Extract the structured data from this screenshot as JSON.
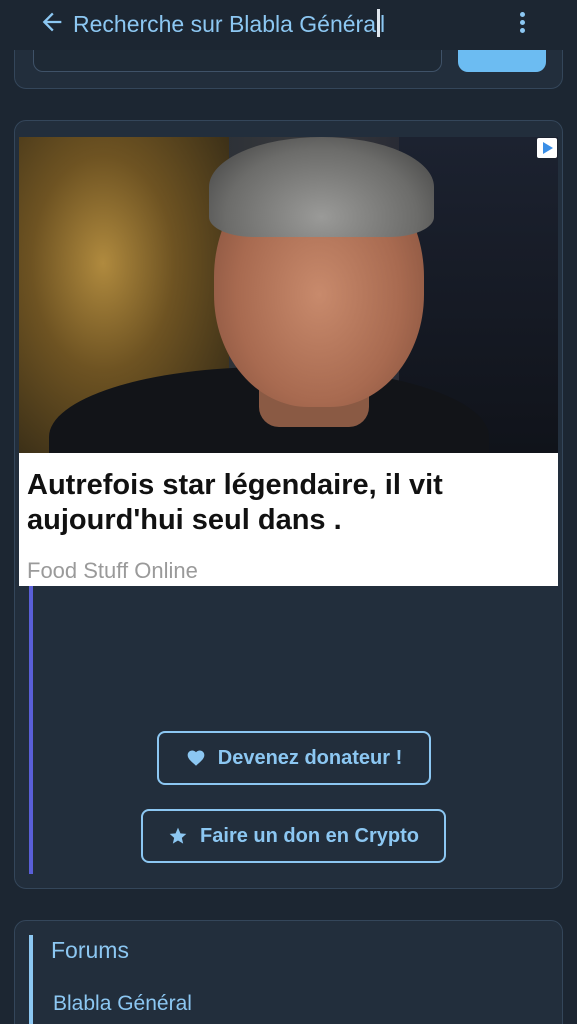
{
  "header": {
    "title": "Recherche sur Blabla Généra",
    "title_tail": "l"
  },
  "ad": {
    "headline": "Autrefois star légendaire, il vit aujourd'hui seul dans .",
    "source": "Food Stuff Online"
  },
  "donation": {
    "donate_label": "Devenez donateur !",
    "crypto_label": "Faire un don en Crypto"
  },
  "forums": {
    "title": "Forums",
    "items": [
      {
        "label": "Blabla Général"
      }
    ]
  },
  "colors": {
    "background": "#1c2632",
    "card": "#222e3c",
    "accent": "#8cc7f2",
    "ad_bar": "#5a5fd8"
  },
  "icons": {
    "back": "arrow-left-icon",
    "menu": "more-vertical-icon",
    "donate": "heart-icon",
    "crypto": "star-icon",
    "ad_choice": "ad-choices-icon"
  }
}
